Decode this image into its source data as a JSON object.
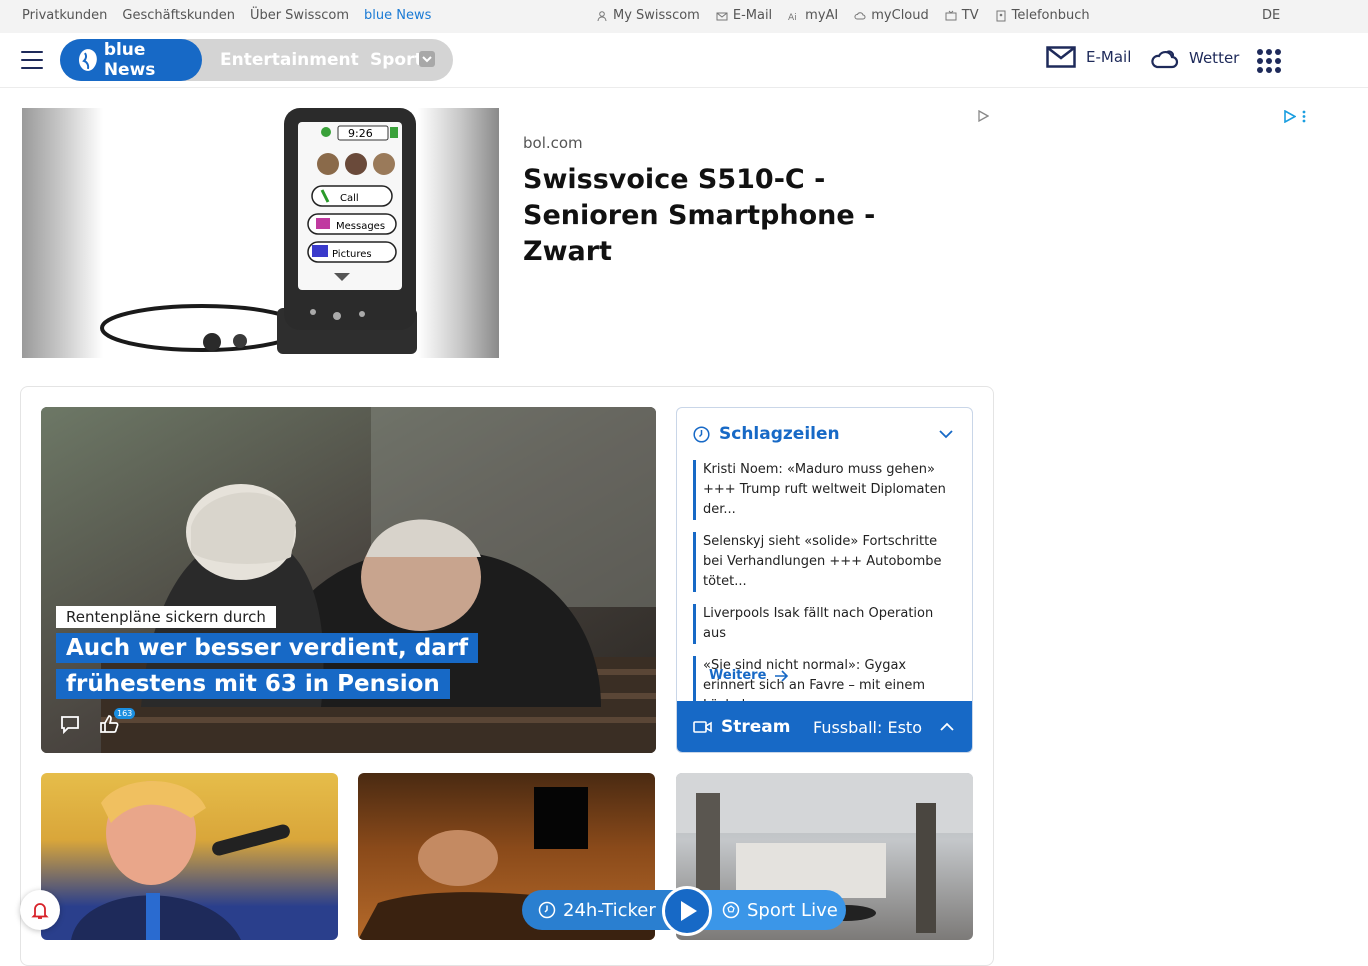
{
  "topbar": {
    "links": [
      "Privatkunden",
      "Geschäftskunden",
      "Über Swisscom",
      "blue News"
    ],
    "services": [
      {
        "label": "My Swisscom",
        "icon": "user-icon"
      },
      {
        "label": "E-Mail",
        "icon": "mail-icon"
      },
      {
        "label": "myAI",
        "icon": "ai-icon"
      },
      {
        "label": "myCloud",
        "icon": "cloud-icon"
      },
      {
        "label": "TV",
        "icon": "tv-icon"
      },
      {
        "label": "Telefonbuch",
        "icon": "phonebook-icon"
      }
    ],
    "language": "DE"
  },
  "header": {
    "brand": "blue News",
    "tabs": [
      "Entertainment",
      "Sport"
    ],
    "mail_label": "E-Mail",
    "weather_label": "Wetter"
  },
  "ad": {
    "source": "bol.com",
    "title": "Swissvoice S510-C - Senioren Smartphone - Zwart",
    "phone_time": "9:26",
    "phone_buttons": [
      "Call",
      "Messages",
      "Pictures"
    ]
  },
  "hero": {
    "kicker": "Rentenpläne sickern durch",
    "headline": "Auch wer besser verdient, darf frühestens mit 63 in Pension",
    "likes": "163"
  },
  "schlagzeilen": {
    "title": "Schlagzeilen",
    "items": [
      "Kristi Noem: «Maduro muss gehen» +++ Trump ruft weltweit Diplomaten der...",
      "Selenskyj sieht «solide» Fortschritte bei Verhandlungen +++ Autobombe tötet...",
      "Liverpools Isak fällt nach Operation aus",
      "«Sie sind nicht normal»: Gygax erinnert sich an Favre – mit einem Lächeln"
    ],
    "more": "Weitere",
    "stream_label": "Stream",
    "stream_text": "Fussball: Estoril"
  },
  "floating": {
    "ticker": "24h-Ticker",
    "sport": "Sport Live"
  },
  "colors": {
    "brand_blue": "#1769c6",
    "navy": "#1e2a5a"
  }
}
